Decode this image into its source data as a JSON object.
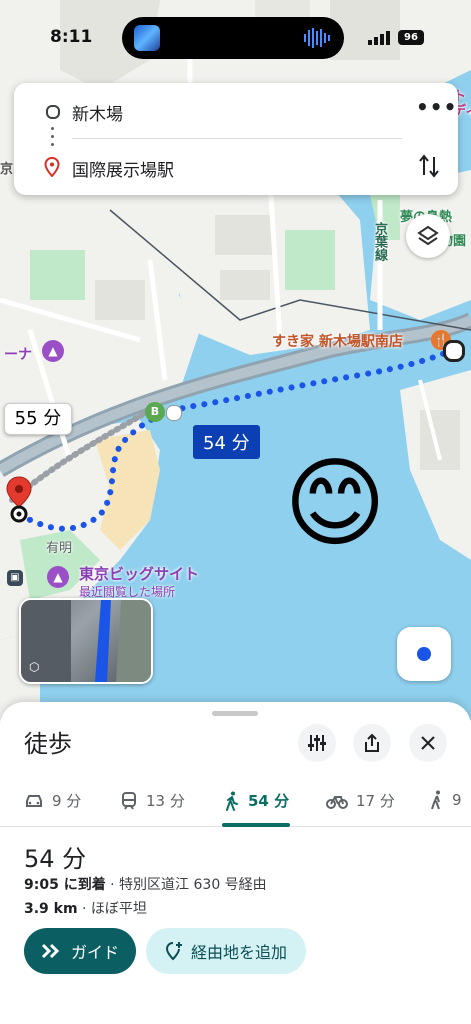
{
  "status": {
    "time": "8:11",
    "battery": "96"
  },
  "search": {
    "origin": "新木場",
    "destination": "国際展示場駅"
  },
  "map": {
    "labels": {
      "sukiya": "すき家 新木場駅南店",
      "keiyo_line": "京葉線",
      "ariake": "有明",
      "big_sight": "東京ビッグサイト",
      "recently_viewed": "最近閲覧した場所",
      "arena": "ーナ",
      "yume": "夢の島熱",
      "shokubutsu": "物園",
      "top_right": "ート",
      "top_right2": "ーディ",
      "kyo": "京"
    },
    "callouts": {
      "alt_route": "55 分",
      "selected_route": "54 分"
    },
    "station_marker": "B"
  },
  "sheet": {
    "title": "徒歩",
    "modes": [
      {
        "icon": "car-icon",
        "label": "9 分"
      },
      {
        "icon": "train-icon",
        "label": "13 分"
      },
      {
        "icon": "walk-icon",
        "label": "54 分",
        "active": true
      },
      {
        "icon": "bike-icon",
        "label": "17 分"
      },
      {
        "icon": "walk2-icon",
        "label": "9"
      }
    ],
    "duration": "54 分",
    "arrival_label": "9:05 に到着",
    "via": " · 特別区道江 630 号経由",
    "distance": "3.9 km",
    "terrain": " · ほぼ平坦",
    "guide_button": "ガイド",
    "add_stop_button": "経由地を追加"
  },
  "colors": {
    "water": "#8fd0ee",
    "land": "#f1f1ee",
    "route": "#1a55e8",
    "accent": "#0b6e63"
  }
}
